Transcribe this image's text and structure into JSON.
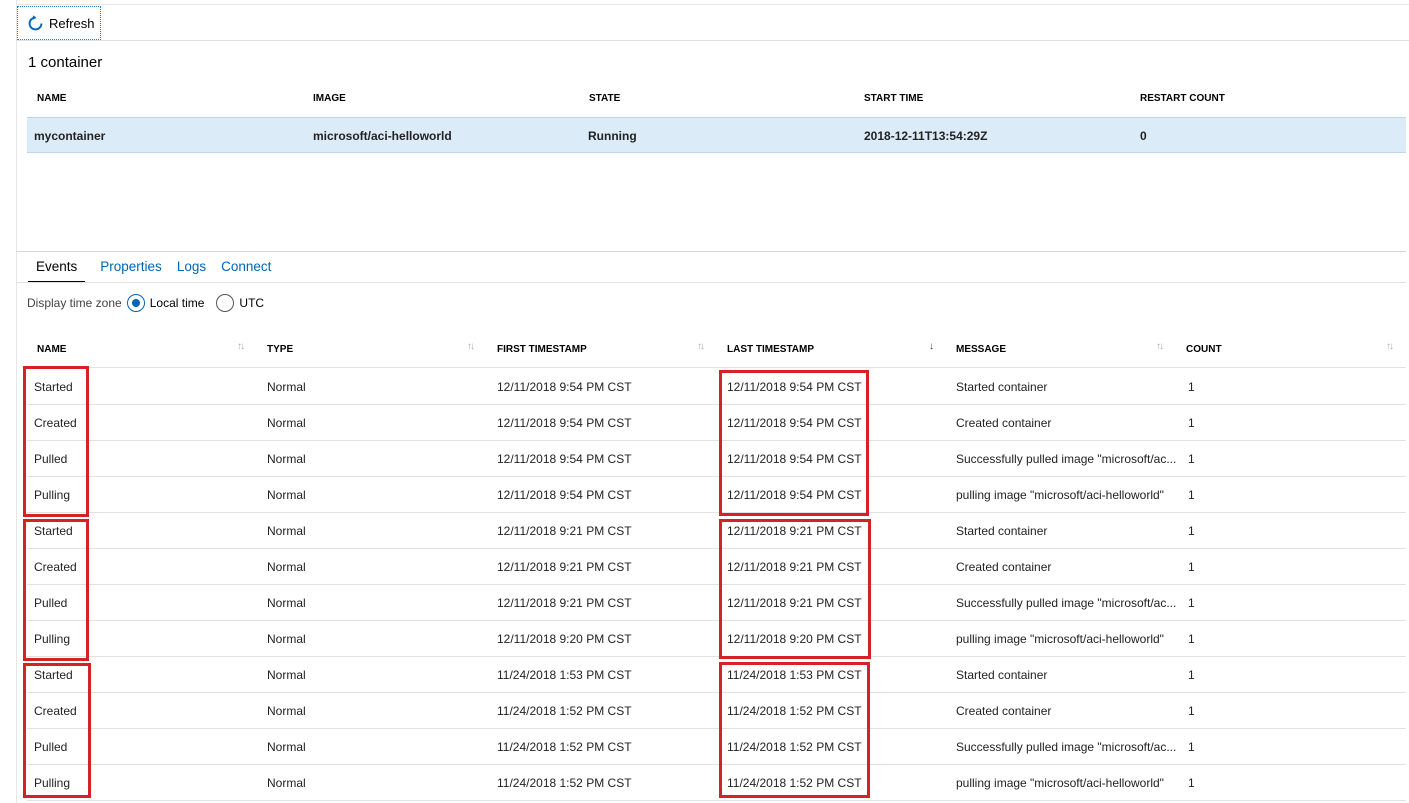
{
  "toolbar": {
    "refresh_label": "Refresh"
  },
  "containers": {
    "count_title": "1 container",
    "columns": [
      "NAME",
      "IMAGE",
      "STATE",
      "START TIME",
      "RESTART COUNT"
    ],
    "rows": [
      {
        "name": "mycontainer",
        "image": "microsoft/aci-helloworld",
        "state": "Running",
        "start_time": "2018-12-11T13:54:29Z",
        "restart_count": "0"
      }
    ]
  },
  "tabs": [
    "Events",
    "Properties",
    "Logs",
    "Connect"
  ],
  "active_tab": "Events",
  "timezone": {
    "label": "Display time zone",
    "options": [
      "Local time",
      "UTC"
    ],
    "selected": "Local time"
  },
  "events": {
    "columns": [
      "NAME",
      "TYPE",
      "FIRST TIMESTAMP",
      "LAST TIMESTAMP",
      "MESSAGE",
      "COUNT"
    ],
    "sorted_by": "LAST TIMESTAMP",
    "sort_direction": "descending",
    "rows": [
      {
        "name": "Started",
        "type": "Normal",
        "first": "12/11/2018 9:54 PM CST",
        "last": "12/11/2018 9:54 PM CST",
        "message": "Started container",
        "count": "1"
      },
      {
        "name": "Created",
        "type": "Normal",
        "first": "12/11/2018 9:54 PM CST",
        "last": "12/11/2018 9:54 PM CST",
        "message": "Created container",
        "count": "1"
      },
      {
        "name": "Pulled",
        "type": "Normal",
        "first": "12/11/2018 9:54 PM CST",
        "last": "12/11/2018 9:54 PM CST",
        "message": "Successfully pulled image \"microsoft/ac...",
        "count": "1"
      },
      {
        "name": "Pulling",
        "type": "Normal",
        "first": "12/11/2018 9:54 PM CST",
        "last": "12/11/2018 9:54 PM CST",
        "message": "pulling image \"microsoft/aci-helloworld\"",
        "count": "1"
      },
      {
        "name": "Started",
        "type": "Normal",
        "first": "12/11/2018 9:21 PM CST",
        "last": "12/11/2018 9:21 PM CST",
        "message": "Started container",
        "count": "1"
      },
      {
        "name": "Created",
        "type": "Normal",
        "first": "12/11/2018 9:21 PM CST",
        "last": "12/11/2018 9:21 PM CST",
        "message": "Created container",
        "count": "1"
      },
      {
        "name": "Pulled",
        "type": "Normal",
        "first": "12/11/2018 9:21 PM CST",
        "last": "12/11/2018 9:21 PM CST",
        "message": "Successfully pulled image \"microsoft/ac...",
        "count": "1"
      },
      {
        "name": "Pulling",
        "type": "Normal",
        "first": "12/11/2018 9:20 PM CST",
        "last": "12/11/2018 9:20 PM CST",
        "message": "pulling image \"microsoft/aci-helloworld\"",
        "count": "1"
      },
      {
        "name": "Started",
        "type": "Normal",
        "first": "11/24/2018 1:53 PM CST",
        "last": "11/24/2018 1:53 PM CST",
        "message": "Started container",
        "count": "1"
      },
      {
        "name": "Created",
        "type": "Normal",
        "first": "11/24/2018 1:52 PM CST",
        "last": "11/24/2018 1:52 PM CST",
        "message": "Created container",
        "count": "1"
      },
      {
        "name": "Pulled",
        "type": "Normal",
        "first": "11/24/2018 1:52 PM CST",
        "last": "11/24/2018 1:52 PM CST",
        "message": "Successfully pulled image \"microsoft/ac...",
        "count": "1"
      },
      {
        "name": "Pulling",
        "type": "Normal",
        "first": "11/24/2018 1:52 PM CST",
        "last": "11/24/2018 1:52 PM CST",
        "message": "pulling image \"microsoft/aci-helloworld\"",
        "count": "1"
      }
    ]
  },
  "colors": {
    "accent": "#0066b8",
    "selected_row": "#dcebf8",
    "highlight": "#d72128"
  },
  "icons": {
    "refresh": "refresh-icon",
    "sort": "sort-arrows-icon",
    "sort_desc": "sort-descending-icon"
  }
}
